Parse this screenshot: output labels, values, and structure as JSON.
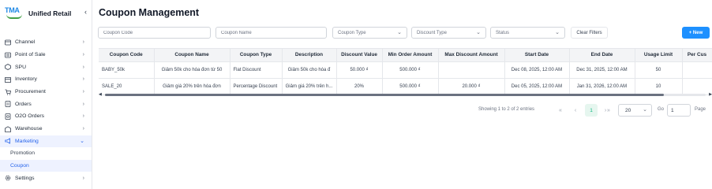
{
  "brand": {
    "logo_text": "TMA",
    "name": "Unified Retail",
    "collapse_icon": "‹"
  },
  "sidebar": {
    "items": [
      {
        "label": "Channel",
        "icon": "channel-icon"
      },
      {
        "label": "Point of Sale",
        "icon": "pos-icon"
      },
      {
        "label": "SPU",
        "icon": "spu-icon"
      },
      {
        "label": "Inventory",
        "icon": "inventory-icon"
      },
      {
        "label": "Procurement",
        "icon": "procurement-icon"
      },
      {
        "label": "Orders",
        "icon": "orders-icon"
      },
      {
        "label": "O2O Orders",
        "icon": "o2o-icon"
      },
      {
        "label": "Warehouse",
        "icon": "warehouse-icon"
      },
      {
        "label": "Marketing",
        "icon": "marketing-icon",
        "active": true,
        "expanded": true
      }
    ],
    "subitems": [
      {
        "label": "Promotion"
      },
      {
        "label": "Coupon",
        "active": true
      }
    ],
    "settings": {
      "label": "Settings",
      "icon": "gear-icon"
    }
  },
  "main": {
    "title": "Coupon Management",
    "filters": {
      "coupon_code_placeholder": "Coupon Code",
      "coupon_name_placeholder": "Coupon Name",
      "coupon_type": "Coupon Type",
      "discount_type": "Discount Type",
      "status": "Status",
      "clear_label": "Clear Filters",
      "new_label": "+ New"
    },
    "table": {
      "columns": [
        "Coupon Code",
        "Coupon Name",
        "Coupon Type",
        "Description",
        "Discount Value",
        "Min Order Amount",
        "Max Discount Amount",
        "Start Date",
        "End Date",
        "Usage Limit",
        "Per Cus"
      ],
      "rows": [
        [
          "BABY_50k",
          "Giảm 50k cho hóa đơn từ 50",
          "Flat Discount",
          "Giảm 50k cho hóa đ",
          "50.000 ₫",
          "500.000 ₫",
          "",
          "Dec 08, 2025, 12:00 AM",
          "Dec 31, 2025, 12:00 AM",
          "50",
          ""
        ],
        [
          "SALE_20",
          "Giảm giá 20% trên hóa đơn",
          "Percentage Discount",
          "Giảm giá 20% trên h...",
          "20%",
          "500.000 ₫",
          "20.000 ₫",
          "Dec 05, 2025, 12:00 AM",
          "Jan 31, 2026, 12:00 AM",
          "10",
          ""
        ]
      ]
    },
    "pagination": {
      "info": "Showing 1 to 2 of 2 entries",
      "first": "«",
      "prev": "‹",
      "current_page": "1",
      "next": "›",
      "last": "»",
      "page_size": "20",
      "go_label": "Go",
      "go_value": "1",
      "page_label": "Page"
    }
  },
  "colors": {
    "accent": "#1e90ff",
    "active_bg": "#eef2ff",
    "active_text": "#2563eb",
    "page_active": "#10b981"
  }
}
